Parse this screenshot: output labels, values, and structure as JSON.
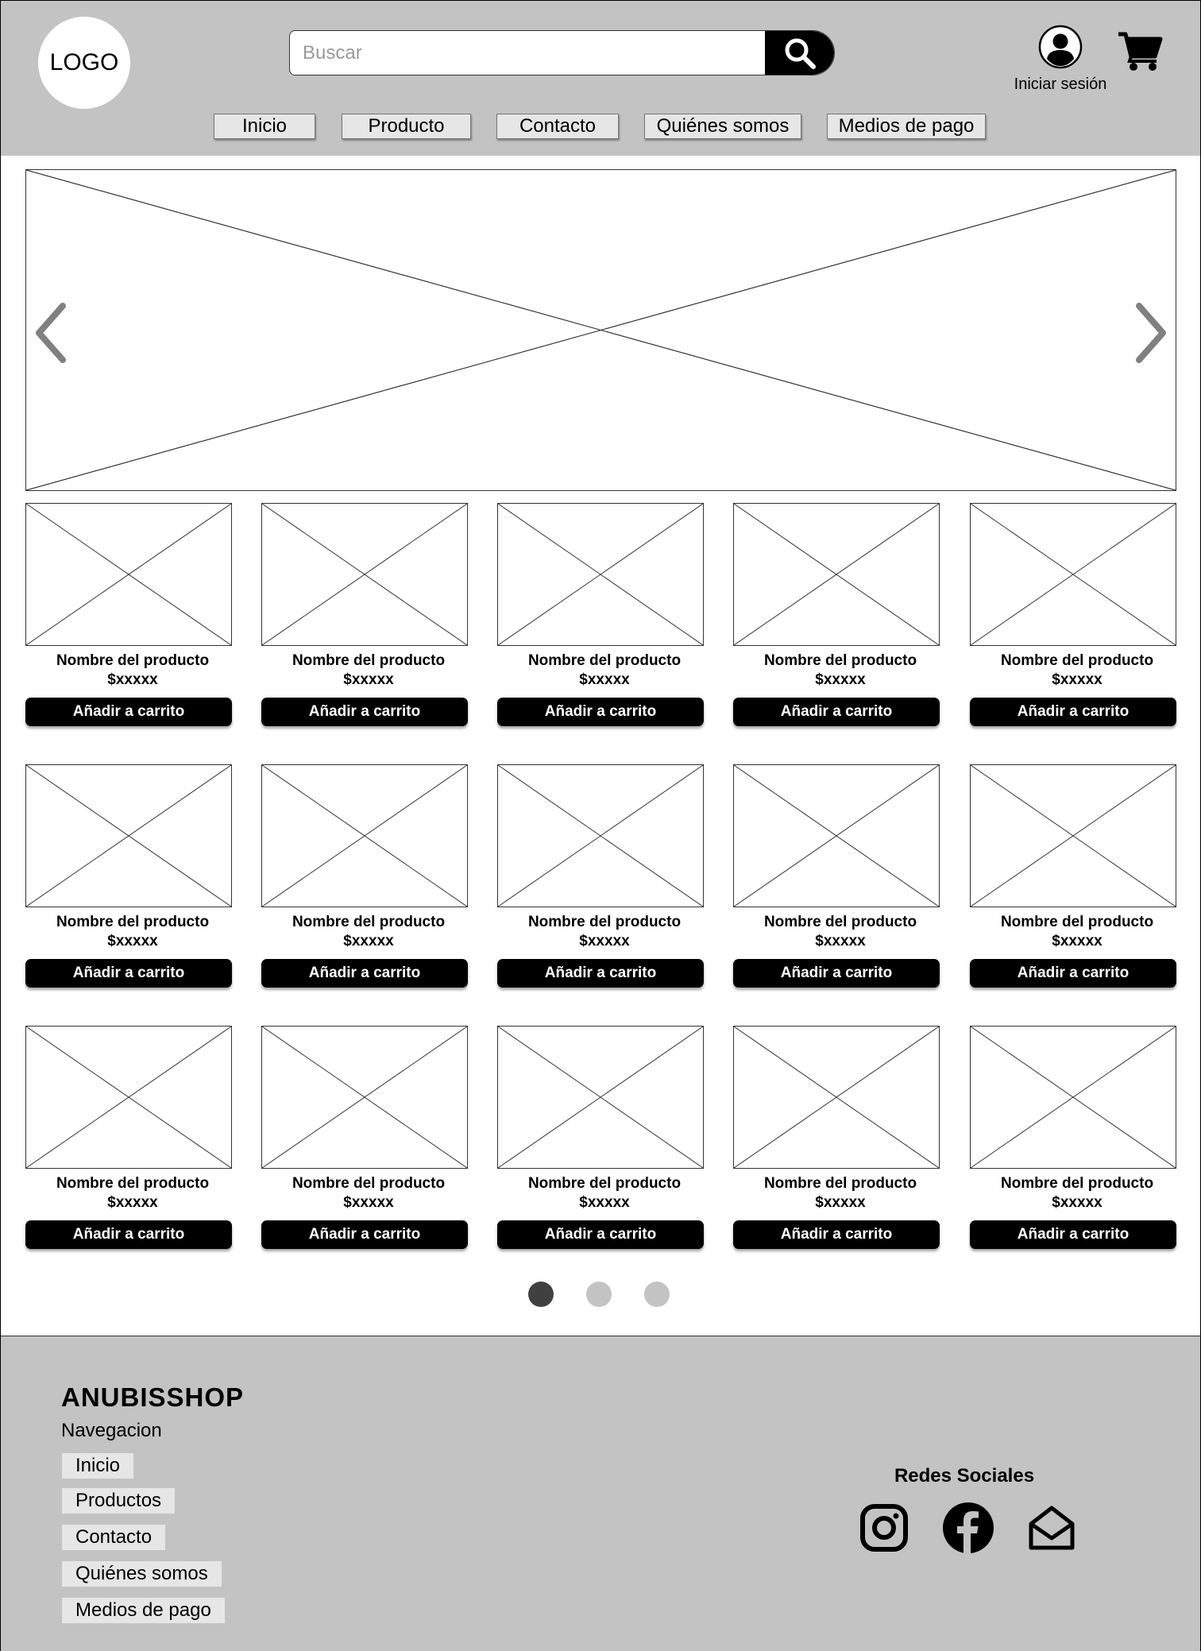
{
  "header": {
    "logo_text": "LOGO",
    "search_placeholder": "Buscar",
    "login_label": "Iniciar sesión",
    "nav": [
      {
        "label": "Inicio"
      },
      {
        "label": "Producto"
      },
      {
        "label": "Contacto"
      },
      {
        "label": "Quiénes somos"
      },
      {
        "label": "Medios de pago"
      }
    ]
  },
  "products": [
    {
      "name": "Nombre del producto",
      "price": "$xxxxx",
      "button": "Añadir a carrito"
    },
    {
      "name": "Nombre del producto",
      "price": "$xxxxx",
      "button": "Añadir a carrito"
    },
    {
      "name": "Nombre del producto",
      "price": "$xxxxx",
      "button": "Añadir a carrito"
    },
    {
      "name": "Nombre del producto",
      "price": "$xxxxx",
      "button": "Añadir a carrito"
    },
    {
      "name": "Nombre del producto",
      "price": "$xxxxx",
      "button": "Añadir a carrito"
    },
    {
      "name": "Nombre del producto",
      "price": "$xxxxx",
      "button": "Añadir a carrito"
    },
    {
      "name": "Nombre del producto",
      "price": "$xxxxx",
      "button": "Añadir a carrito"
    },
    {
      "name": "Nombre del producto",
      "price": "$xxxxx",
      "button": "Añadir a carrito"
    },
    {
      "name": "Nombre del producto",
      "price": "$xxxxx",
      "button": "Añadir a carrito"
    },
    {
      "name": "Nombre del producto",
      "price": "$xxxxx",
      "button": "Añadir a carrito"
    },
    {
      "name": "Nombre del producto",
      "price": "$xxxxx",
      "button": "Añadir a carrito"
    },
    {
      "name": "Nombre del producto",
      "price": "$xxxxx",
      "button": "Añadir a carrito"
    },
    {
      "name": "Nombre del producto",
      "price": "$xxxxx",
      "button": "Añadir a carrito"
    },
    {
      "name": "Nombre del producto",
      "price": "$xxxxx",
      "button": "Añadir a carrito"
    },
    {
      "name": "Nombre del producto",
      "price": "$xxxxx",
      "button": "Añadir a carrito"
    }
  ],
  "pagination": {
    "active_page": 1,
    "pages": 3,
    "active_color": "#404040",
    "inactive_color": "#c3c3c3"
  },
  "footer": {
    "brand": "ANUBISSHOP",
    "nav_title": "Navegacion",
    "links": [
      {
        "label": "Inicio"
      },
      {
        "label": "Productos"
      },
      {
        "label": "Contacto"
      },
      {
        "label": "Quiénes somos"
      },
      {
        "label": "Medios de pago"
      }
    ],
    "social_title": "Redes Sociales",
    "social_icons": [
      "instagram-icon",
      "facebook-icon",
      "email-icon"
    ]
  },
  "colors": {
    "header_bg": "#c3c3c3",
    "accent": "#000000",
    "nav_btn_bg": "#e6e6e6"
  }
}
